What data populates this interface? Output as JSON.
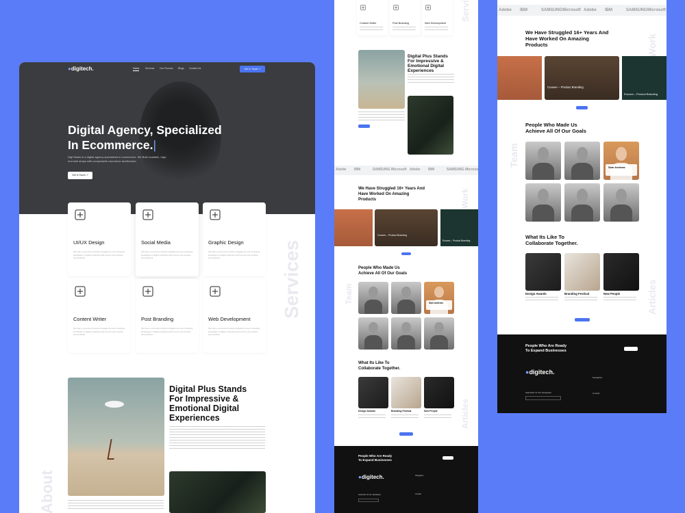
{
  "brand": "digitech.",
  "nav": [
    "Home",
    "Services",
    "Our Process",
    "Blogs",
    "Contact Us"
  ],
  "cta": "Get In Touch",
  "hero": {
    "line1": "Digital Agency, Specialized",
    "line2": "In Ecommerce.",
    "desc1": "Digi Studio is a digital agency specialized in ecommerce. We Build scalable, high-",
    "desc2": "end web shops with composable commerce architecture."
  },
  "services": [
    {
      "name": "UI/UX Design",
      "icon": "rocket-icon"
    },
    {
      "name": "Social Media",
      "icon": "share-network-icon"
    },
    {
      "name": "Graphic Design",
      "icon": "pen-tool-icon"
    },
    {
      "name": "Content Writer",
      "icon": "book-icon"
    },
    {
      "name": "Post Branding",
      "icon": "brand-icon"
    },
    {
      "name": "Web Development",
      "icon": "code-board-icon"
    }
  ],
  "service_desc": "We help e-commerce brands navigate the ever changing landscape of digital marketing with end-to-end creative, personalized.",
  "ghost": {
    "services": "Services",
    "about": "About",
    "team": "Team",
    "work": "Work",
    "articles": "Articles"
  },
  "about": {
    "title": [
      "Digital Plus Stands",
      "For Impressive &",
      "Emotional Digital",
      "Experiences"
    ]
  },
  "logos": [
    "Adobe",
    "IBM",
    "SAMSUNG",
    "Microsoft",
    "Adobe",
    "IBM",
    "SAMSUNG",
    "Microsoft"
  ],
  "work": {
    "title": [
      "We Have Struggled 16+ Years And",
      "Have Worked On Amazing",
      "Products"
    ],
    "items": [
      "Couvee – Product Branding",
      "Eouvea – Product Branding"
    ]
  },
  "team": {
    "title": [
      "People Who Made Us",
      "Achieve All Of Our Goals"
    ],
    "featured": "Sam Andreas"
  },
  "articles": {
    "title": [
      "What Its Like To",
      "Collaborate Together."
    ],
    "items": [
      "Design Awards",
      "Branding Festival",
      "New People"
    ]
  },
  "footer": {
    "cta": [
      "People Who Are Ready",
      "To Expand Businesses"
    ],
    "navigation": "Navigation",
    "contact": "Contact",
    "subscribe": "Subscribe To Our Newsletter"
  },
  "colors": {
    "accent": "#4b74f0",
    "background": "#5b7cf8",
    "dark": "#111111"
  }
}
